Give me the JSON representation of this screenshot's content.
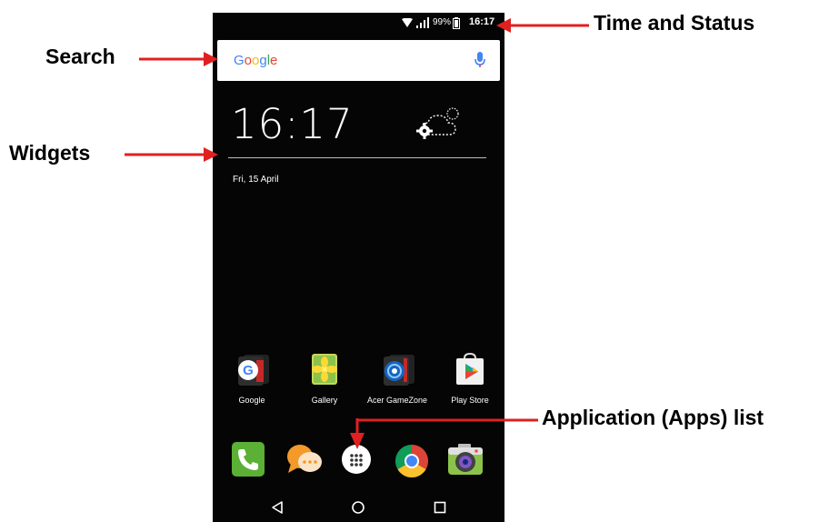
{
  "status_bar": {
    "battery_percent": "99%",
    "time": "16:17"
  },
  "search": {
    "logo_text": "Google"
  },
  "clock_widget": {
    "time": "16:17",
    "date": "Fri, 15 April"
  },
  "apps": [
    {
      "label": "Google",
      "icon": "google-folder-icon"
    },
    {
      "label": "Gallery",
      "icon": "gallery-icon"
    },
    {
      "label": "Acer GameZone",
      "icon": "gamezone-folder-icon"
    },
    {
      "label": "Play Store",
      "icon": "play-store-icon"
    }
  ],
  "dock": [
    {
      "icon": "phone-icon"
    },
    {
      "icon": "messaging-icon"
    },
    {
      "icon": "apps-launcher-icon"
    },
    {
      "icon": "chrome-icon"
    },
    {
      "icon": "camera-icon"
    }
  ],
  "nav_bar": [
    {
      "icon": "back-icon"
    },
    {
      "icon": "home-icon"
    },
    {
      "icon": "recents-icon"
    }
  ],
  "annotations": {
    "time_and_status": "Time and Status",
    "search": "Search",
    "widgets": "Widgets",
    "apps_list": "Application (Apps) list"
  },
  "colors": {
    "arrow": "#e02020",
    "screen_background": "#050505",
    "phone_green": "#5bb035",
    "messaging_orange": "#f39a2b"
  }
}
